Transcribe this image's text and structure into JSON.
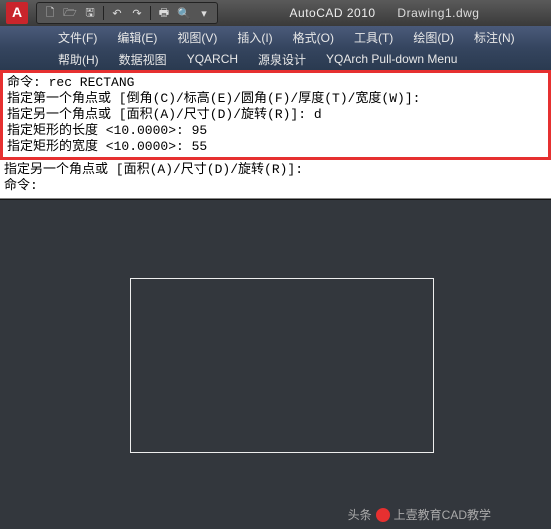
{
  "titlebar": {
    "app_logo": "A",
    "app_name": "AutoCAD 2010",
    "doc_name": "Drawing1.dwg",
    "qat": {
      "new": "🗋",
      "open": "🗁",
      "save": "🖫",
      "undo": "↶",
      "redo": "↷",
      "print": "🖶",
      "find": "🔍",
      "dropdown": "▾"
    }
  },
  "menu1": {
    "file": "文件(F)",
    "edit": "编辑(E)",
    "view": "视图(V)",
    "insert": "插入(I)",
    "format": "格式(O)",
    "tools": "工具(T)",
    "draw": "绘图(D)",
    "annotate": "标注(N)"
  },
  "menu2": {
    "help": "帮助(H)",
    "dataview": "数据视图",
    "yqarch": "YQARCH",
    "yuanquan": "源泉设计",
    "pulldown": "YQArch Pull-down Menu"
  },
  "command_box": {
    "l1": "命令: rec RECTANG",
    "l2": "指定第一个角点或 [倒角(C)/标高(E)/圆角(F)/厚度(T)/宽度(W)]:",
    "l3": "指定另一个角点或 [面积(A)/尺寸(D)/旋转(R)]: d",
    "l4": "指定矩形的长度 <10.0000>: 95",
    "l5": "指定矩形的宽度 <10.0000>: 55"
  },
  "command_after": {
    "l6": "指定另一个角点或 [面积(A)/尺寸(D)/旋转(R)]:",
    "l7": "命令:"
  },
  "watermark": {
    "prefix": "头条",
    "text": "上壹教育CAD教学"
  }
}
